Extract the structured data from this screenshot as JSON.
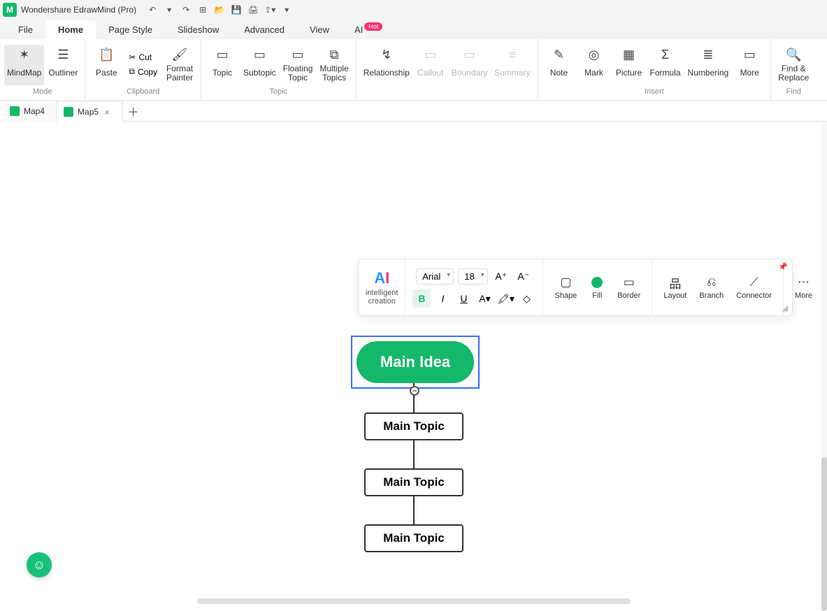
{
  "app": {
    "title": "Wondershare EdrawMind (Pro)"
  },
  "menu": {
    "tabs": [
      "File",
      "Home",
      "Page Style",
      "Slideshow",
      "Advanced",
      "View",
      "AI"
    ],
    "active": "Home",
    "ai_badge": "Hot"
  },
  "ribbon": {
    "mode": {
      "label": "Mode",
      "mindmap": "MindMap",
      "outliner": "Outliner"
    },
    "clipboard": {
      "label": "Clipboard",
      "paste": "Paste",
      "cut": "Cut",
      "copy": "Copy",
      "format_painter": "Format\nPainter"
    },
    "topic": {
      "label": "Topic",
      "topic": "Topic",
      "subtopic": "Subtopic",
      "floating": "Floating\nTopic",
      "multiple": "Multiple\nTopics"
    },
    "relationship": "Relationship",
    "callout": "Callout",
    "boundary": "Boundary",
    "summary": "Summary",
    "insert": {
      "label": "Insert",
      "note": "Note",
      "mark": "Mark",
      "picture": "Picture",
      "formula": "Formula",
      "numbering": "Numbering",
      "more": "More"
    },
    "find": {
      "label": "Find",
      "find_replace": "Find &\nReplace"
    }
  },
  "docTabs": {
    "tabs": [
      "Map4",
      "Map5"
    ],
    "active": "Map5"
  },
  "ctx": {
    "ai_line1": "intelligent",
    "ai_line2": "creation",
    "font_name": "Arial",
    "font_size": "18",
    "grow": "A⁺",
    "shrink": "A⁻",
    "bold": "B",
    "italic": "I",
    "underline": "U",
    "shape": "Shape",
    "fill": "Fill",
    "border": "Border",
    "layout": "Layout",
    "branch": "Branch",
    "connector": "Connector",
    "more": "More"
  },
  "mindmap": {
    "main": "Main Idea",
    "topics": [
      "Main Topic",
      "Main Topic",
      "Main Topic"
    ],
    "collapse_symbol": "−"
  }
}
